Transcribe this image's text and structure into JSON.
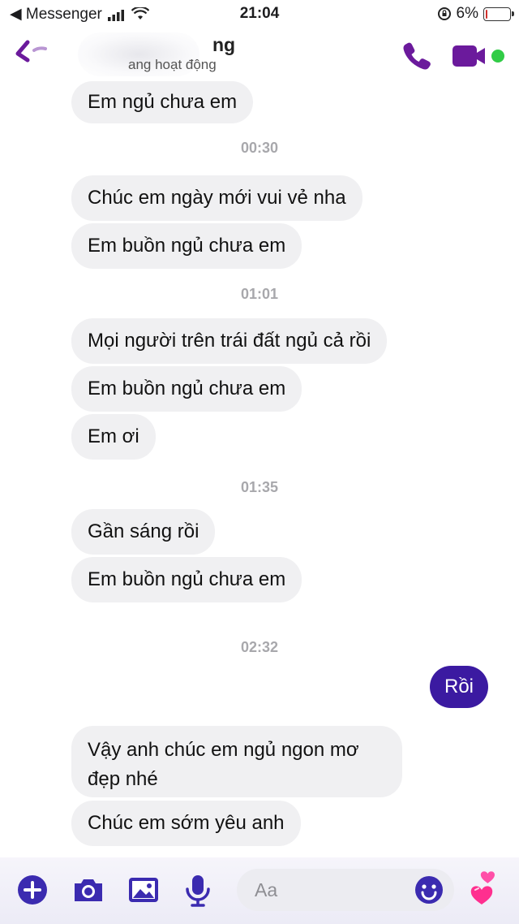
{
  "status_bar": {
    "back_app": "◀ Messenger",
    "time": "21:04",
    "battery_text": "6%",
    "battery_level": 0.06
  },
  "header": {
    "name": "ng",
    "status": "ang hoạt động"
  },
  "messages": [
    {
      "kind": "received",
      "text": "Em ngủ chưa em"
    },
    {
      "kind": "time",
      "text": "00:30"
    },
    {
      "kind": "received",
      "text": "Chúc em ngày mới vui vẻ nha"
    },
    {
      "kind": "received",
      "text": "Em buồn ngủ chưa em"
    },
    {
      "kind": "time",
      "text": "01:01"
    },
    {
      "kind": "received",
      "text": "Mọi người trên trái đất ngủ cả rồi"
    },
    {
      "kind": "received",
      "text": "Em buồn ngủ chưa em"
    },
    {
      "kind": "received",
      "text": "Em ơi"
    },
    {
      "kind": "time",
      "text": "01:35"
    },
    {
      "kind": "received",
      "text": "Gần sáng rồi"
    },
    {
      "kind": "received",
      "text": "Em buồn ngủ chưa em"
    },
    {
      "kind": "time",
      "text": "02:32"
    },
    {
      "kind": "sent",
      "text": "Rồi"
    },
    {
      "kind": "received",
      "text": "Vậy anh chúc em ngủ ngon mơ đẹp nhé"
    },
    {
      "kind": "received",
      "text": "Chúc em sớm yêu anh"
    }
  ],
  "composer": {
    "placeholder": "Aa"
  },
  "colors": {
    "accent": "#6b1a9c",
    "sent_bubble": "#3b1aa1",
    "received_bubble": "#f0f0f2",
    "online": "#31cc46"
  },
  "icons": [
    "back-icon",
    "phone-icon",
    "video-camera-icon",
    "plus-icon",
    "camera-icon",
    "image-icon",
    "microphone-icon",
    "emoji-icon",
    "hearts-icon"
  ]
}
